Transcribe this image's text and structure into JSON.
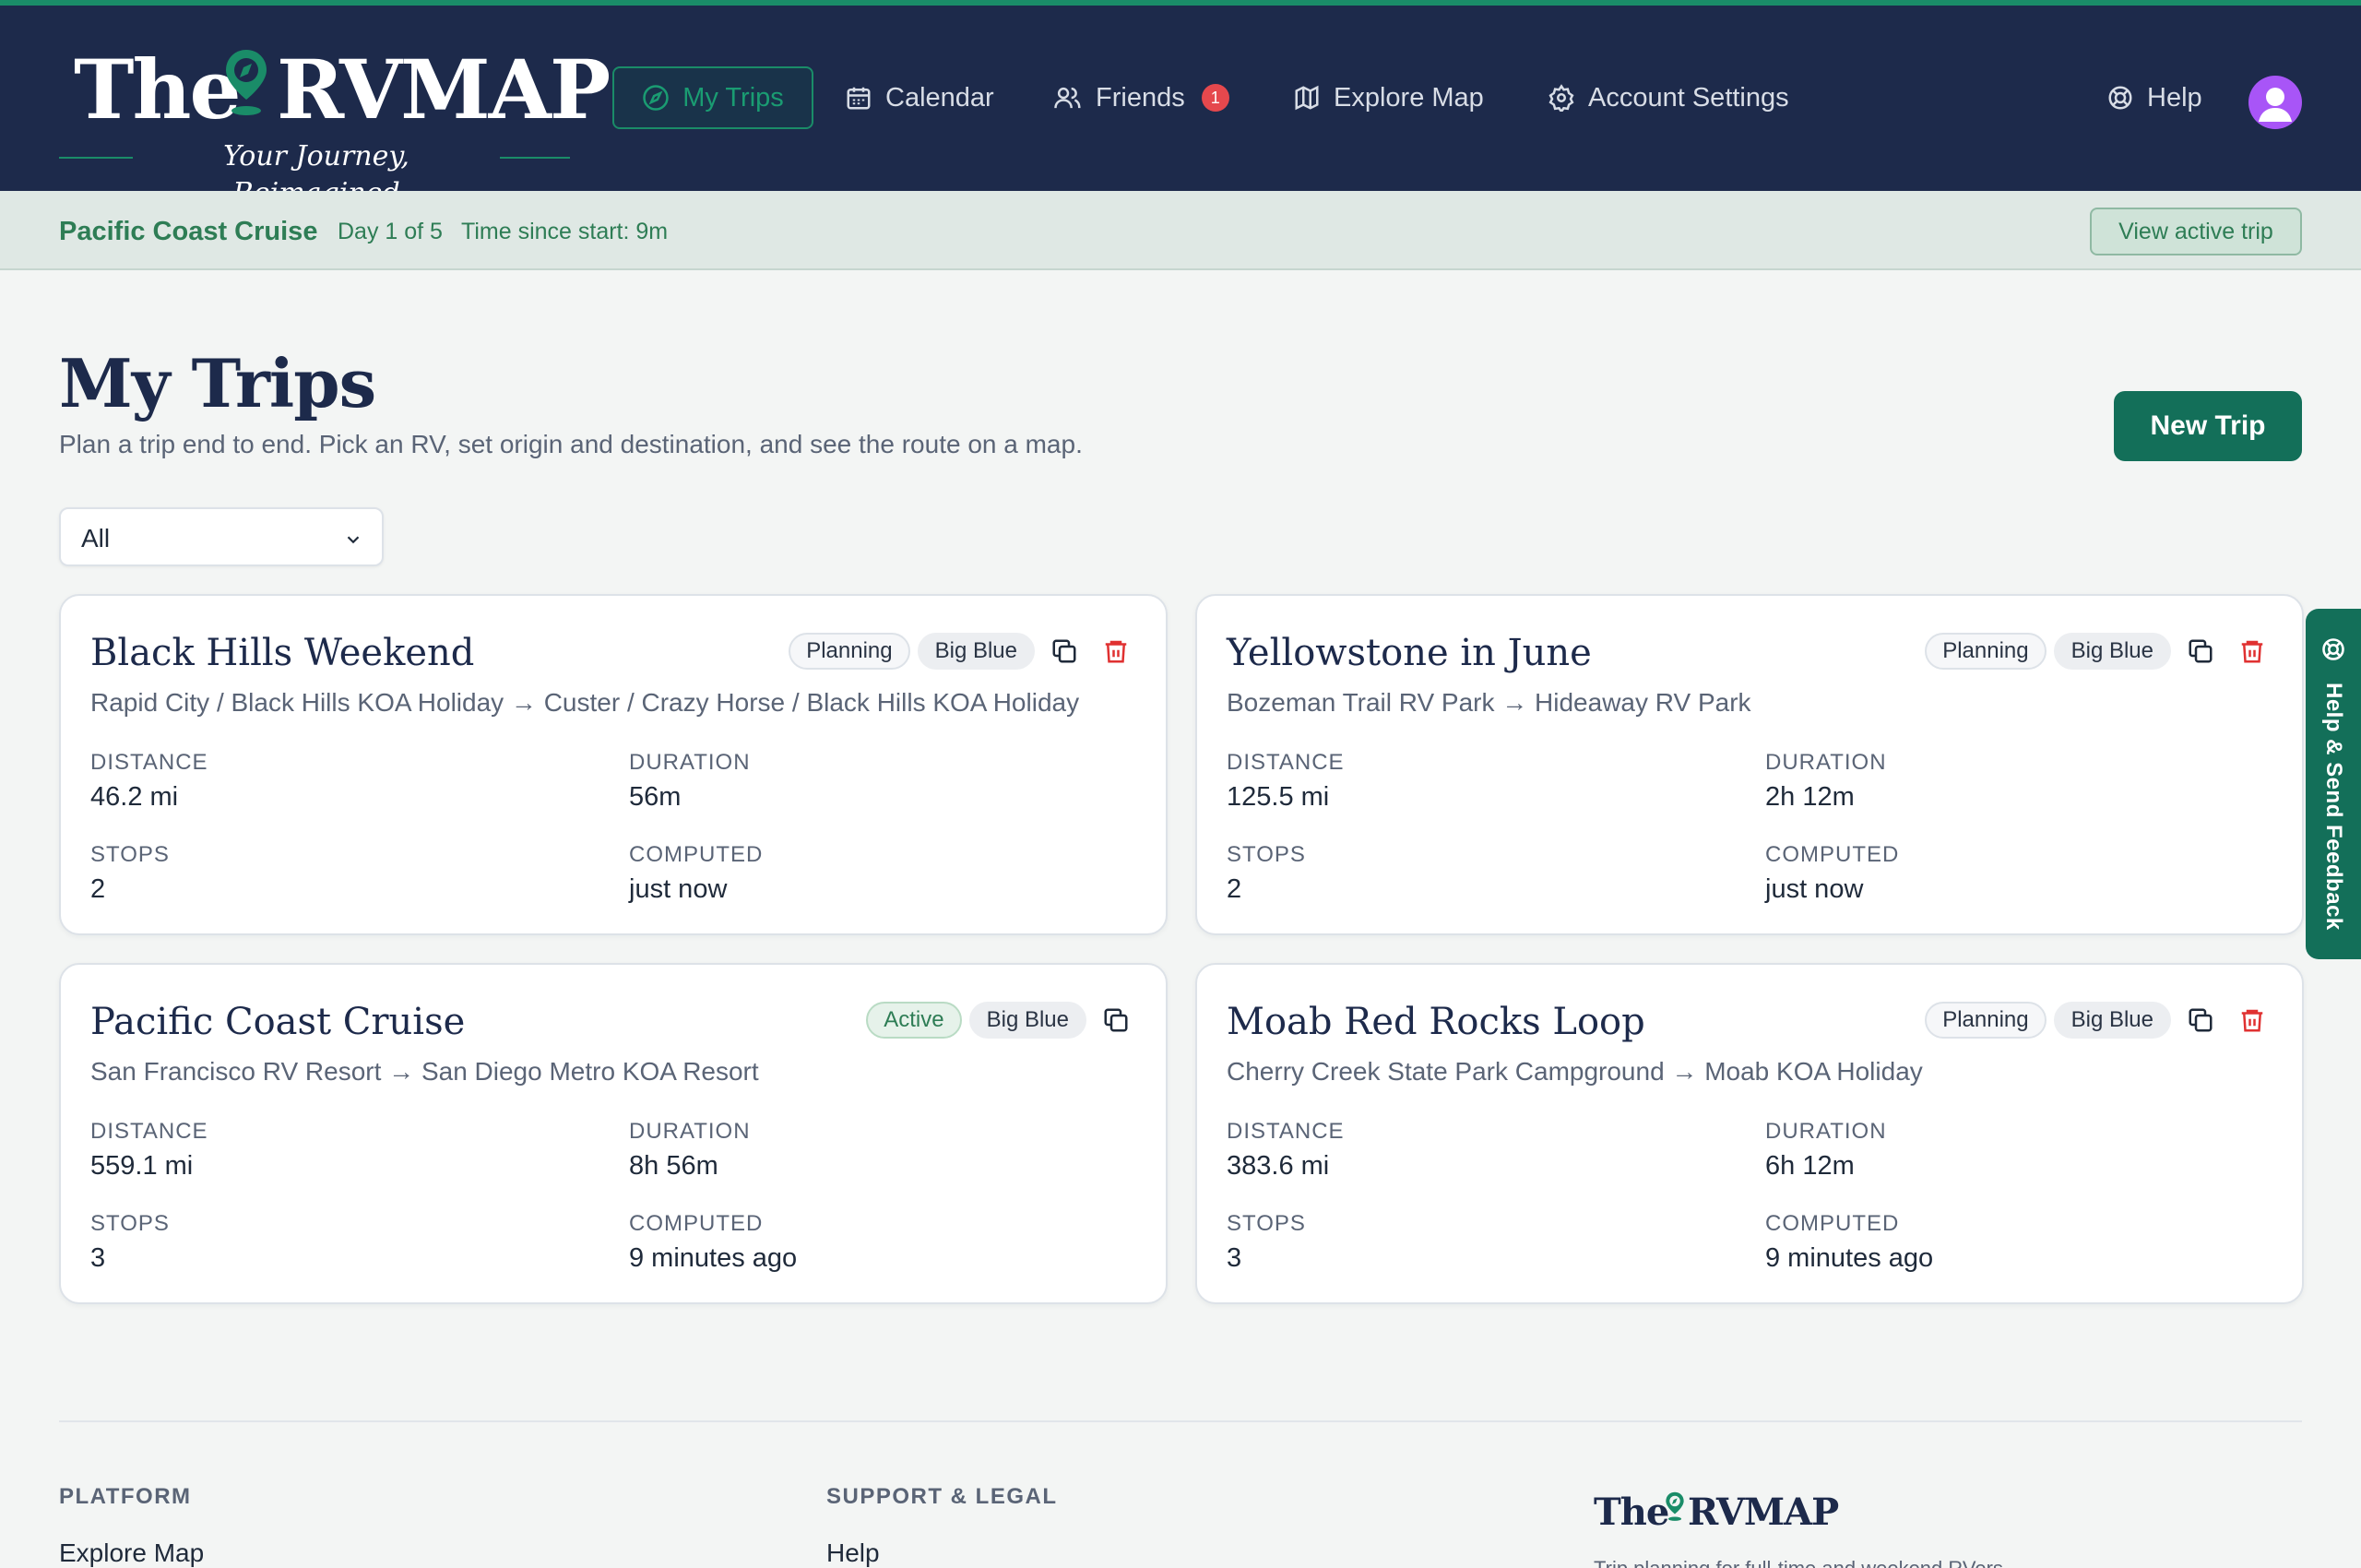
{
  "brand": {
    "word_left": "The",
    "word_right": "RVMAP",
    "tagline": "Your Journey, Reimagined",
    "accent": "#1a8c68",
    "header_bg": "#1d2a4b"
  },
  "nav": {
    "my_trips": "My Trips",
    "calendar": "Calendar",
    "friends": "Friends",
    "friends_badge": "1",
    "explore_map": "Explore Map",
    "account_settings": "Account Settings",
    "help": "Help"
  },
  "active_trip": {
    "name": "Pacific Coast Cruise",
    "day": "Day 1 of 5",
    "time_since_start": "Time since start: 9m",
    "view_label": "View active trip"
  },
  "page": {
    "title": "My Trips",
    "subtitle": "Plan a trip end to end. Pick an RV, set origin and destination, and see the route on a map.",
    "new_trip_label": "New Trip",
    "filter_value": "All"
  },
  "labels": {
    "distance": "DISTANCE",
    "duration": "DURATION",
    "stops": "STOPS",
    "computed": "COMPUTED"
  },
  "trips": [
    {
      "title": "Black Hills Weekend",
      "route": "Rapid City / Black Hills KOA Holiday → Custer / Crazy Horse / Black Hills KOA Holiday",
      "status": "Planning",
      "rv": "Big Blue",
      "distance": "46.2 mi",
      "duration": "56m",
      "stops": "2",
      "computed": "just now"
    },
    {
      "title": "Yellowstone in June",
      "route": "Bozeman Trail RV Park → Hideaway RV Park",
      "status": "Planning",
      "rv": "Big Blue",
      "distance": "125.5 mi",
      "duration": "2h 12m",
      "stops": "2",
      "computed": "just now"
    },
    {
      "title": "Pacific Coast Cruise",
      "route": "San Francisco RV Resort → San Diego Metro KOA Resort",
      "status": "Active",
      "rv": "Big Blue",
      "distance": "559.1 mi",
      "duration": "8h 56m",
      "stops": "3",
      "computed": "9 minutes ago"
    },
    {
      "title": "Moab Red Rocks Loop",
      "route": "Cherry Creek State Park Campground → Moab KOA Holiday",
      "status": "Planning",
      "rv": "Big Blue",
      "distance": "383.6 mi",
      "duration": "6h 12m",
      "stops": "3",
      "computed": "9 minutes ago"
    }
  ],
  "feedback": {
    "label": "Help & Send Feedback"
  },
  "footer": {
    "platform_heading": "PLATFORM",
    "platform_link_1": "Explore Map",
    "support_heading": "SUPPORT & LEGAL",
    "support_link_1": "Help",
    "brand_desc": "Trip planning for full-time and weekend RVers"
  }
}
